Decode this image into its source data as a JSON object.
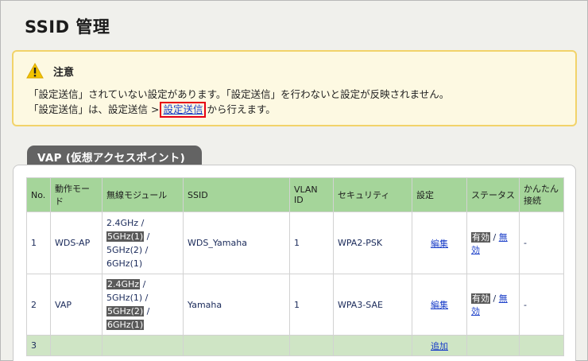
{
  "page": {
    "title": "SSID 管理"
  },
  "notice": {
    "title": "注意",
    "line1": "「設定送信」されていない設定があります。「設定送信」を行わないと設定が反映されません。",
    "line2_prefix": "「設定送信」は、設定送信 >",
    "line2_link": "設定送信",
    "line2_suffix": "から行えます。",
    "highlight_color": "#e60012"
  },
  "vap_section": {
    "title": "VAP (仮想アクセスポイント)",
    "headers": {
      "no": "No.",
      "mode": "動作モード",
      "module": "無線モジュール",
      "ssid": "SSID",
      "vlan": "VLAN ID",
      "security": "セキュリティ",
      "settings": "設定",
      "status": "ステータス",
      "easy_line1": "かんたん",
      "easy_line2": "接続"
    },
    "rows": [
      {
        "no": "1",
        "mode": "WDS-AP",
        "modules": [
          {
            "label": "2.4GHz",
            "sep": " /",
            "selected": false
          },
          {
            "label": "5GHz(1)",
            "sep": " /",
            "selected": true
          },
          {
            "label": "5GHz(2)",
            "sep": " /",
            "selected": false
          },
          {
            "label": "6GHz(1)",
            "sep": "",
            "selected": false
          }
        ],
        "ssid": "WDS_Yamaha",
        "vlan": "1",
        "security": "WPA2-PSK",
        "edit": "編集",
        "status_on": "有効",
        "status_sep": " / ",
        "status_off": "無効",
        "easy": "-"
      },
      {
        "no": "2",
        "mode": "VAP",
        "modules": [
          {
            "label": "2.4GHz",
            "sep": " /",
            "selected": true
          },
          {
            "label": "5GHz(1)",
            "sep": " /",
            "selected": false
          },
          {
            "label": "5GHz(2)",
            "sep": " /",
            "selected": true
          },
          {
            "label": "6GHz(1)",
            "sep": "",
            "selected": true
          }
        ],
        "ssid": "Yamaha",
        "vlan": "1",
        "security": "WPA3-SAE",
        "edit": "編集",
        "status_on": "有効",
        "status_sep": " / ",
        "status_off": "無効",
        "easy": "-"
      },
      {
        "no": "3",
        "add": "追加"
      }
    ]
  },
  "colors": {
    "header_bg": "#a5d59a",
    "empty_row_bg": "#cfe5c5",
    "tab_bg": "#636363",
    "link": "#1a3ec8"
  }
}
